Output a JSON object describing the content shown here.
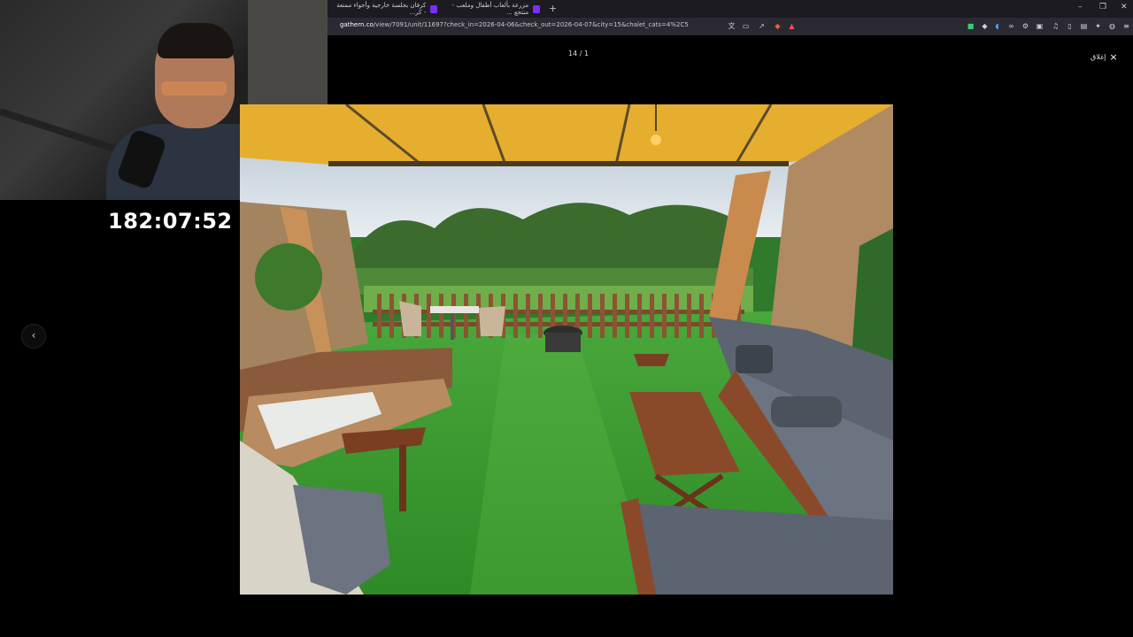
{
  "browser": {
    "tabs": [
      {
        "title": "كرفان بجلسة خارجية وأجواء ممتعة - كر..."
      },
      {
        "title": "مزرعة بألعاب أطفال وملعب - منتجع ..."
      }
    ],
    "new_tab_label": "+",
    "url_host": "gathern.co",
    "url_path": "/view/7091/unit/11697?check_in=2026-04-06&check_out=2026-04-07&city=15&chalet_cats=4%2C5"
  },
  "stream": {
    "timer": "182:07:52"
  },
  "viewer": {
    "counter": "14 / 1",
    "close_label": "إغلاق",
    "close_icon": "×",
    "prev_icon": "‹"
  },
  "colors": {
    "awning": "#e6ae2e",
    "grass": "#3f9a34",
    "sofa": "#5b6470",
    "wood": "#8a4a2a"
  }
}
